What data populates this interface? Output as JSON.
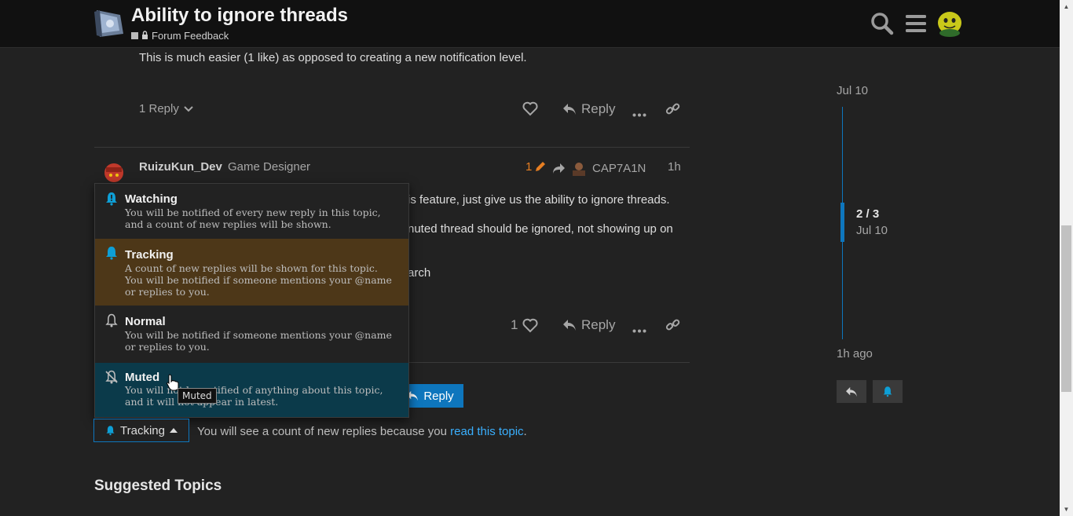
{
  "header": {
    "title": "Ability to ignore threads",
    "category": "Forum Feedback",
    "icons": [
      "search-icon",
      "hamburger-menu-icon",
      "user-avatar"
    ]
  },
  "post1": {
    "body": "This is much easier (1 like) as opposed to creating a new notification level.",
    "replies_label": "1 Reply",
    "reply_label": "Reply"
  },
  "post2": {
    "username": "RuizuKun_Dev",
    "user_title": "Game Designer",
    "edit_count": "1",
    "reply_to_user": "CAP7A1N",
    "age": "1h",
    "line1": "is feature, just give us the ability to ignore threads.",
    "line2": "nuted thread should be ignored, not showing up on",
    "line3": "arch",
    "like_count": "1",
    "reply_label": "Reply"
  },
  "notification_menu": {
    "items": [
      {
        "title": "Watching",
        "desc": "You will be notified of every new reply in this topic, and a count of new replies will be shown."
      },
      {
        "title": "Tracking",
        "desc": "A count of new replies will be shown for this topic. You will be notified if someone mentions your @name or replies to you."
      },
      {
        "title": "Normal",
        "desc": "You will be notified if someone mentions your @name or replies to you."
      },
      {
        "title": "Muted",
        "desc": "You will not be notified of anything about this topic, and it will not appear in latest."
      }
    ],
    "tooltip": "Muted"
  },
  "footer": {
    "reply_button": "Reply",
    "tracking_button": "Tracking",
    "status_prefix": "You will see a count of new replies because you ",
    "status_link": "read this topic",
    "status_suffix": "."
  },
  "suggested_heading": "Suggested Topics",
  "timeline": {
    "top_date": "Jul 10",
    "position": "2 / 3",
    "position_date": "Jul 10",
    "bottom_label": "1h ago"
  },
  "colors": {
    "accent": "#0e76bd",
    "tracking_highlight": "#4d3718",
    "muted_highlight": "#0b3a4a",
    "edit_orange": "#e67e22"
  }
}
